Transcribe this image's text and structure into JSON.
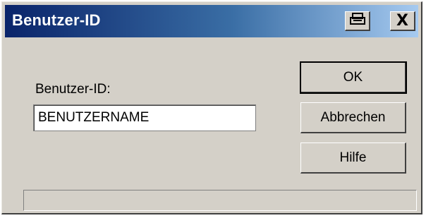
{
  "window": {
    "title": "Benutzer-ID",
    "help_icon": "context-help-icon",
    "close_label": "X"
  },
  "form": {
    "label": "Benutzer-ID:",
    "value": "BENUTZERNAME"
  },
  "buttons": {
    "ok": "OK",
    "cancel": "Abbrechen",
    "help": "Hilfe"
  },
  "status": {
    "text": ""
  },
  "colors": {
    "titlebar_start": "#0a246a",
    "titlebar_end": "#a6caf0",
    "face": "#d4d0c8"
  }
}
